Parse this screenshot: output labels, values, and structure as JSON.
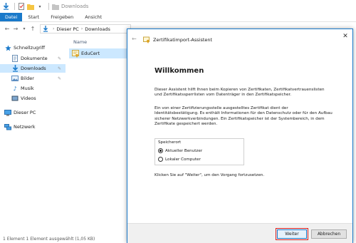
{
  "explorer": {
    "title": "Downloads",
    "ribbon_tabs": [
      "Datei",
      "Start",
      "Freigeben",
      "Ansicht"
    ],
    "breadcrumb": [
      "Dieser PC",
      "Downloads"
    ],
    "column_name": "Name",
    "sidebar": [
      {
        "label": "Schnellzugriff",
        "icon": "star-icon"
      },
      {
        "label": "Dokumente",
        "icon": "document-icon"
      },
      {
        "label": "Downloads",
        "icon": "download-icon"
      },
      {
        "label": "Bilder",
        "icon": "picture-icon"
      },
      {
        "label": "Musik",
        "icon": "music-icon"
      },
      {
        "label": "Videos",
        "icon": "video-icon"
      },
      {
        "label": "Dieser PC",
        "icon": "computer-icon"
      },
      {
        "label": "Netzwerk",
        "icon": "network-icon"
      }
    ],
    "file": {
      "name": "EduCert",
      "icon": "certificate-file-icon"
    },
    "status": "1 Element   1 Element ausgewählt (1,05 KB)"
  },
  "wizard": {
    "title": "Zertifikatimport-Assistent",
    "heading": "Willkommen",
    "para1": "Dieser Assistent hilft Ihnen beim Kopieren von Zertifikaten, Zertifikatvertrauenslisten und Zertifikatssperrlisten vom Datenträger in den Zertifikatspeicher.",
    "para2": "Ein von einer Zertifizierungsstelle ausgestelltes Zertifikat dient der Identitätsbestätigung. Es enthält Informationen für den Datenschutz oder für den Aufbau sicherer Netzwerkverbindungen. Ein Zertifikatspeicher ist der Systembereich, in dem Zertifikate gespeichert werden.",
    "store_label": "Speicherort",
    "options": [
      "Aktueller Benutzer",
      "Lokaler Computer"
    ],
    "selected_option": "Aktueller Benutzer",
    "para3": "Klicken Sie auf \"Weiter\", um den Vorgang fortzusetzen.",
    "next_button": "Weiter",
    "cancel_button": "Abbrechen"
  },
  "colors": {
    "accent": "#1979ca",
    "selection": "#cce8ff",
    "highlight": "#d91e1e"
  }
}
